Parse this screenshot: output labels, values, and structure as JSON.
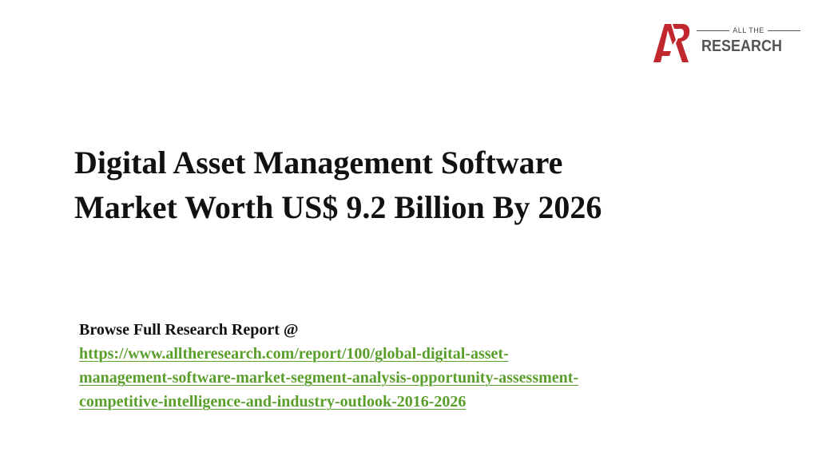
{
  "logo": {
    "mark_text": "AR",
    "top_text": "ALL THE",
    "bottom_text": "RESEARCH",
    "mark_color": "#c0282d",
    "text_color": "#555555"
  },
  "title": {
    "line1": "Digital Asset Management Software",
    "line2": "Market Worth US$ 9.2 Billion By 2026"
  },
  "browse": {
    "label": "Browse Full Research Report @",
    "link_line1": "https://www.alltheresearch.com/report/100/global-digital-asset-",
    "link_line2": "management-software-market-segment-analysis-opportunity-assessment-",
    "link_line3": "competitive-intelligence-and-industry-outlook-2016-2026",
    "link_color": "#5a9e2b"
  }
}
